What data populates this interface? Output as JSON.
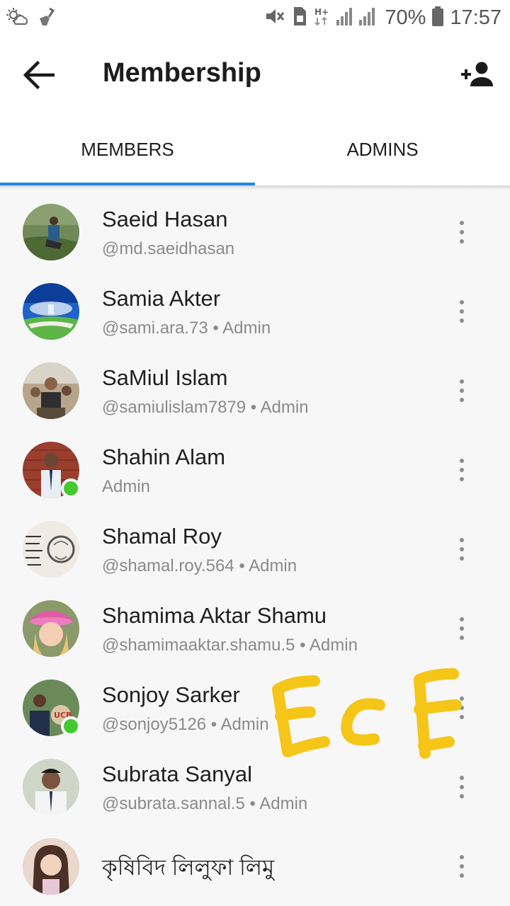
{
  "status_bar": {
    "battery": "70%",
    "time": "17:57",
    "network": "H+",
    "icons": [
      "weather-icon",
      "cleaner-icon",
      "mute-icon",
      "sim-icon",
      "signal-icon",
      "battery-icon"
    ]
  },
  "app_bar": {
    "title": "Membership",
    "back_icon": "arrow-left-icon",
    "add_icon": "add-person-icon"
  },
  "tabs": [
    {
      "label": "MEMBERS",
      "active": true
    },
    {
      "label": "ADMINS",
      "active": false
    }
  ],
  "members": [
    {
      "name": "Saeid Hasan",
      "subtitle": "@md.saeidhasan",
      "online": false
    },
    {
      "name": "Samia Akter",
      "subtitle": "@sami.ara.73 • Admin",
      "online": false
    },
    {
      "name": "SaMiul Islam",
      "subtitle": "@samiulislam7879 • Admin",
      "online": false
    },
    {
      "name": "Shahin Alam",
      "subtitle": "Admin",
      "online": true
    },
    {
      "name": "Shamal Roy",
      "subtitle": "@shamal.roy.564 • Admin",
      "online": false
    },
    {
      "name": "Shamima Aktar Shamu",
      "subtitle": "@shamimaaktar.shamu.5 • Admin",
      "online": false
    },
    {
      "name": "Sonjoy Sarker",
      "subtitle": "@sonjoy5126 • Admin",
      "online": true
    },
    {
      "name": "Subrata Sanyal",
      "subtitle": "@subrata.sannal.5 • Admin",
      "online": false
    },
    {
      "name": "কৃষিবিদ লিলুফা লিমু",
      "subtitle": "",
      "online": false
    }
  ],
  "watermark": {
    "text": "ECE",
    "color": "#f5c518"
  },
  "colors": {
    "accent": "#1e88e5",
    "online": "#45c832"
  }
}
